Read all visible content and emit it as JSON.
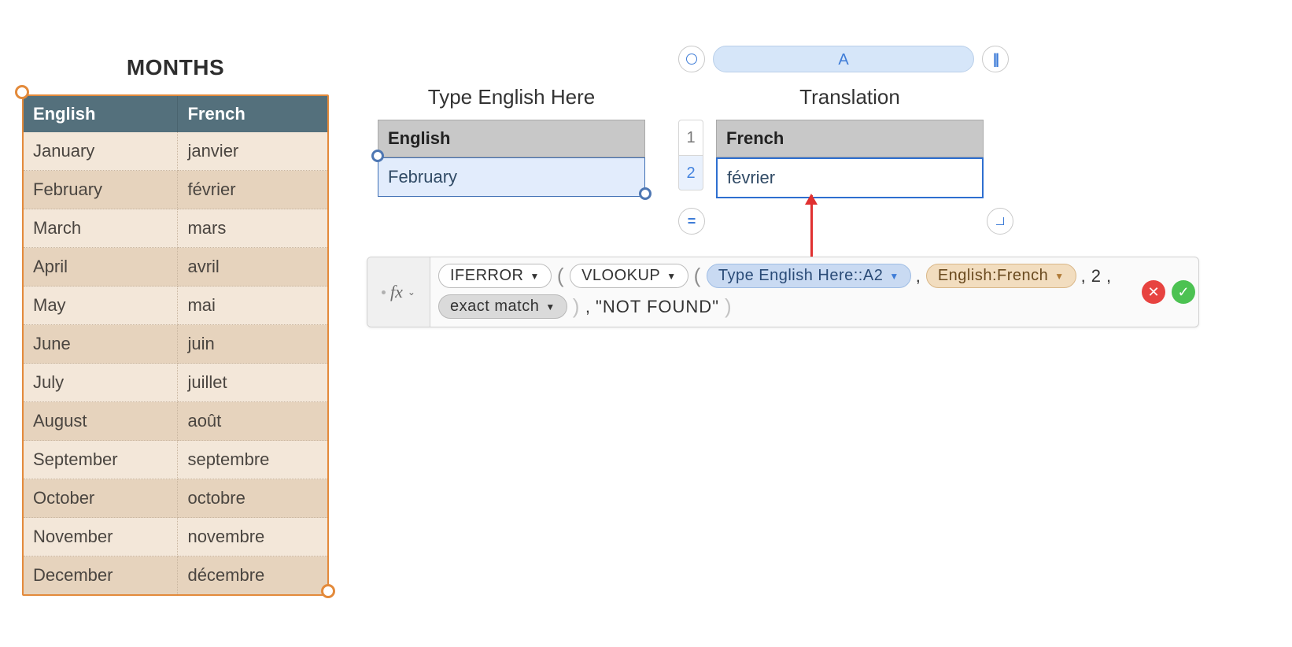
{
  "months": {
    "title": "MONTHS",
    "headers": {
      "english": "English",
      "french": "French"
    },
    "rows": [
      {
        "english": "January",
        "french": "janvier"
      },
      {
        "english": "February",
        "french": "février"
      },
      {
        "english": "March",
        "french": "mars"
      },
      {
        "english": "April",
        "french": "avril"
      },
      {
        "english": "May",
        "french": "mai"
      },
      {
        "english": "June",
        "french": "juin"
      },
      {
        "english": "July",
        "french": "juillet"
      },
      {
        "english": "August",
        "french": "août"
      },
      {
        "english": "September",
        "french": "septembre"
      },
      {
        "english": "October",
        "french": "octobre"
      },
      {
        "english": "November",
        "french": "novembre"
      },
      {
        "english": "December",
        "french": "décembre"
      }
    ]
  },
  "typehere": {
    "title": "Type English Here",
    "header": "English",
    "value": "February"
  },
  "translation": {
    "title": "Translation",
    "header": "French",
    "value": "février"
  },
  "gutter": {
    "row1": "1",
    "row2": "2"
  },
  "colheader": {
    "label": "A",
    "circle": "○",
    "pause": "||",
    "equals": "=",
    "enter": "⏎"
  },
  "formula": {
    "fx": "fx",
    "fn_iferror": "IFERROR",
    "fn_vlookup": "VLOOKUP",
    "ref_typehere": "Type English Here::A2",
    "ref_range": "English:French",
    "arg_colindex": "2",
    "arg_match": "exact match",
    "arg_notfound": "\"NOT FOUND\"",
    "comma": ","
  },
  "icons": {
    "cancel": "✕",
    "confirm": "✓",
    "dropdown": "▼",
    "chevron": "⌄"
  }
}
